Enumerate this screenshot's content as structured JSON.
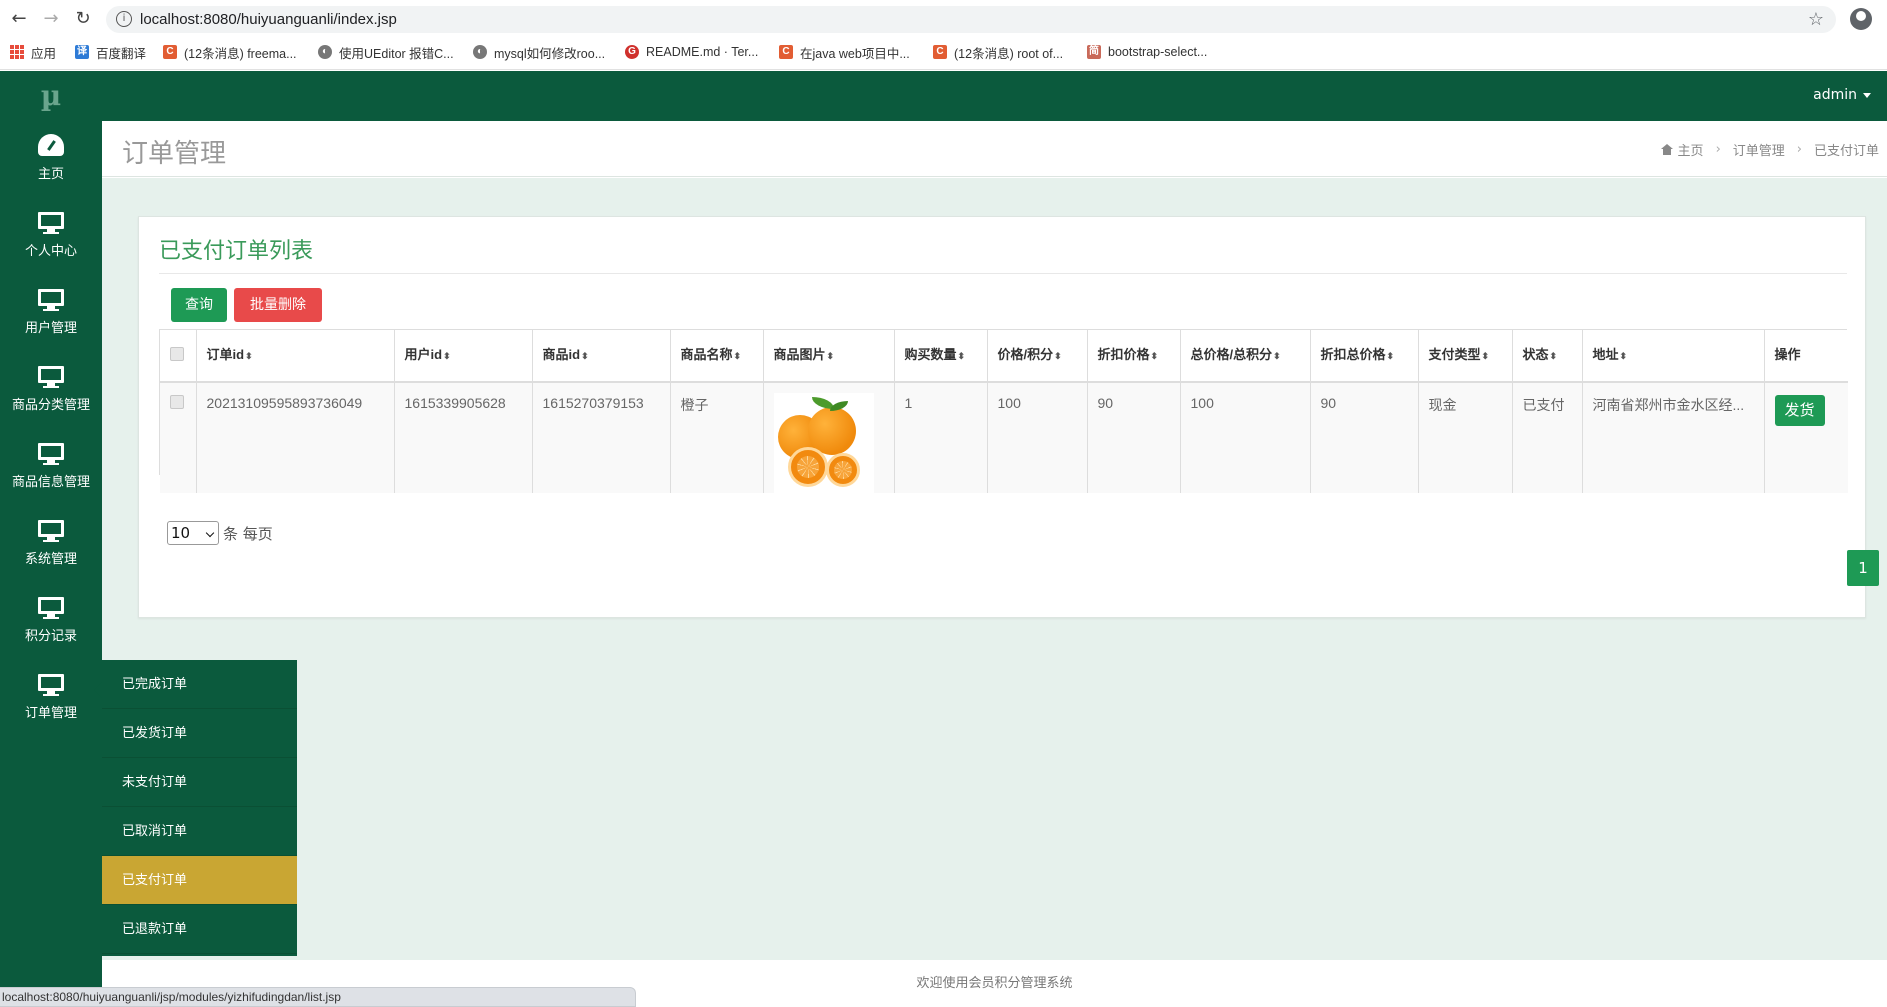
{
  "browser": {
    "url": "localhost:8080/huiyuanguanli/index.jsp",
    "bookmarks": [
      {
        "label": "应用",
        "icon": "apps-grid-icon"
      },
      {
        "label": "百度翻译",
        "icon": "baidu-translate-icon"
      },
      {
        "label": "(12条消息) freema...",
        "icon": "csdn-icon"
      },
      {
        "label": "使用UEditor 报错C...",
        "icon": "github-icon"
      },
      {
        "label": "mysql如何修改roo...",
        "icon": "github-icon"
      },
      {
        "label": "README.md · Ter...",
        "icon": "gitee-icon"
      },
      {
        "label": "在java web项目中...",
        "icon": "csdn-icon"
      },
      {
        "label": "(12条消息) root of...",
        "icon": "csdn-icon"
      },
      {
        "label": "bootstrap-select...",
        "icon": "jianshu-icon"
      }
    ],
    "status_url": "localhost:8080/huiyuanguanli/jsp/modules/yizhifudingdan/list.jsp"
  },
  "app": {
    "logo": "µ",
    "user": "admin",
    "sidebar": [
      {
        "label": "主页",
        "icon": "dashboard-icon"
      },
      {
        "label": "个人中心",
        "icon": "monitor-icon"
      },
      {
        "label": "用户管理",
        "icon": "monitor-icon"
      },
      {
        "label": "商品分类管理",
        "icon": "monitor-icon"
      },
      {
        "label": "商品信息管理",
        "icon": "monitor-icon"
      },
      {
        "label": "系统管理",
        "icon": "monitor-icon"
      },
      {
        "label": "积分记录",
        "icon": "monitor-icon"
      },
      {
        "label": "订单管理",
        "icon": "monitor-icon"
      }
    ],
    "submenu": [
      {
        "label": "已完成订单",
        "active": false
      },
      {
        "label": "已发货订单",
        "active": false
      },
      {
        "label": "未支付订单",
        "active": false
      },
      {
        "label": "已取消订单",
        "active": false
      },
      {
        "label": "已支付订单",
        "active": true
      },
      {
        "label": "已退款订单",
        "active": false
      }
    ],
    "header": {
      "title": "订单管理",
      "breadcrumb": [
        "主页",
        "订单管理",
        "已支付订单"
      ]
    },
    "panel": {
      "title": "已支付订单列表",
      "query_button": "查询",
      "delete_button": "批量删除",
      "columns": [
        "订单id",
        "用户id",
        "商品id",
        "商品名称",
        "商品图片",
        "购买数量",
        "价格/积分",
        "折扣价格",
        "总价格/总积分",
        "折扣总价格",
        "支付类型",
        "状态",
        "地址",
        "操作"
      ],
      "rows": [
        {
          "order_id": "20213109595893736049",
          "user_id": "1615339905628",
          "product_id": "1615270379153",
          "product_name": "橙子",
          "product_image": "orange-image",
          "quantity": "1",
          "price": "100",
          "discount_price": "90",
          "total_price": "100",
          "discount_total": "90",
          "pay_type": "现金",
          "status": "已支付",
          "address": "河南省郑州市金水区经...",
          "action": "发货"
        }
      ],
      "page_size": "10",
      "page_size_suffix": "条 每页",
      "current_page": "1"
    },
    "footer": "欢迎使用会员积分管理系统"
  },
  "colors": {
    "primary_green": "#0b5a3d",
    "button_green": "#1e9a55",
    "danger_red": "#e84a4a",
    "active_gold": "#c9a633",
    "content_bg": "#e6f1ec"
  }
}
